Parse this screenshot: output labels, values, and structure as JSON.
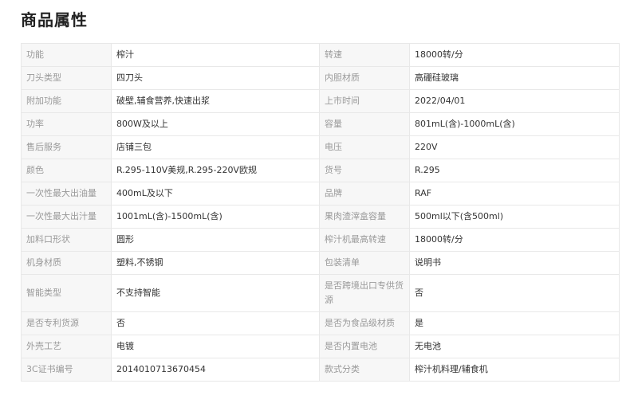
{
  "title": "商品属性",
  "rows": [
    {
      "k1": "功能",
      "v1": "榨汁",
      "k2": "转速",
      "v2": "18000转/分"
    },
    {
      "k1": "刀头类型",
      "v1": "四刀头",
      "k2": "内胆材质",
      "v2": "高硼硅玻璃"
    },
    {
      "k1": "附加功能",
      "v1": "破壁,辅食营养,快速出浆",
      "k2": "上市时间",
      "v2": "2022/04/01"
    },
    {
      "k1": "功率",
      "v1": "800W及以上",
      "k2": "容量",
      "v2": "801mL(含)-1000mL(含)"
    },
    {
      "k1": "售后服务",
      "v1": "店铺三包",
      "k2": "电压",
      "v2": "220V"
    },
    {
      "k1": "颜色",
      "v1": "R.295-110V美规,R.295-220V欧规",
      "k2": "货号",
      "v2": "R.295"
    },
    {
      "k1": "一次性最大出油量",
      "v1": "400mL及以下",
      "k2": "品牌",
      "v2": "RAF"
    },
    {
      "k1": "一次性最大出汁量",
      "v1": "1001mL(含)-1500mL(含)",
      "k2": "果肉渣滓盒容量",
      "v2": "500ml以下(含500ml)"
    },
    {
      "k1": "加料口形状",
      "v1": "圆形",
      "k2": "榨汁机最高转速",
      "v2": "18000转/分"
    },
    {
      "k1": "机身材质",
      "v1": "塑料,不锈钢",
      "k2": "包装清单",
      "v2": "说明书"
    },
    {
      "k1": "智能类型",
      "v1": "不支持智能",
      "k2": "是否跨境出口专供货源",
      "v2": "否"
    },
    {
      "k1": "是否专利货源",
      "v1": "否",
      "k2": "是否为食品级材质",
      "v2": "是"
    },
    {
      "k1": "外壳工艺",
      "v1": "电镀",
      "k2": "是否内置电池",
      "v2": "无电池"
    },
    {
      "k1": "3C证书编号",
      "v1": "2014010713670454",
      "k2": "款式分类",
      "v2": "榨汁机料理/辅食机"
    }
  ]
}
